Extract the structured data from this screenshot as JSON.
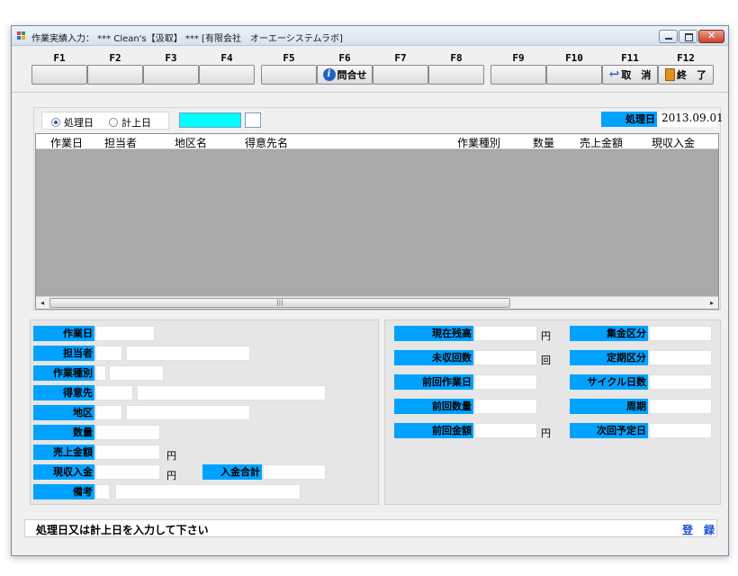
{
  "window": {
    "title": "作業実績入力： *** Clean's【汲取】 *** [有限会社　オーエーシステムラボ]"
  },
  "fkeys": [
    {
      "key": "F1",
      "label": ""
    },
    {
      "key": "F2",
      "label": ""
    },
    {
      "key": "F3",
      "label": ""
    },
    {
      "key": "F4",
      "label": ""
    },
    {
      "key": "F5",
      "label": ""
    },
    {
      "key": "F6",
      "label": "問合せ",
      "icon": "info-icon"
    },
    {
      "key": "F7",
      "label": ""
    },
    {
      "key": "F8",
      "label": ""
    },
    {
      "key": "F9",
      "label": ""
    },
    {
      "key": "F10",
      "label": ""
    },
    {
      "key": "F11",
      "label": "取　消",
      "icon": "undo-arrow-icon"
    },
    {
      "key": "F12",
      "label": "終　了",
      "icon": "exit-door-icon"
    }
  ],
  "search": {
    "radio_process_date": "処理日",
    "radio_posting_date": "計上日",
    "selected_radio": "処理日",
    "date_input_value": "",
    "small_input_value": "",
    "process_date_label": "処理日",
    "process_date_value": "2013.09.01"
  },
  "grid": {
    "columns": [
      "作業日",
      "担当者",
      "地区名",
      "得意先名",
      "作業種別",
      "数量",
      "売上金額",
      "現収入金"
    ],
    "rows": []
  },
  "left_form": {
    "work_date": {
      "label": "作業日",
      "value": ""
    },
    "staff": {
      "label": "担当者",
      "code": "",
      "name": ""
    },
    "work_type": {
      "label": "作業種別",
      "code": "",
      "name": ""
    },
    "customer": {
      "label": "得意先",
      "code": "",
      "name": ""
    },
    "district": {
      "label": "地区",
      "code": "",
      "name": ""
    },
    "quantity": {
      "label": "数量",
      "value": ""
    },
    "sales_amount": {
      "label": "売上金額",
      "value": "",
      "unit": "円"
    },
    "cash_received": {
      "label": "現収入金",
      "value": "",
      "unit": "円"
    },
    "payment_total": {
      "label": "入金合計",
      "value": ""
    },
    "remarks": {
      "label": "備考",
      "code": "",
      "text": ""
    }
  },
  "right_form": {
    "current_balance": {
      "label": "現在残高",
      "value": "",
      "unit": "円"
    },
    "unpaid_count": {
      "label": "未収回数",
      "value": "",
      "unit": "回"
    },
    "prev_work_date": {
      "label": "前回作業日",
      "value": ""
    },
    "prev_quantity": {
      "label": "前回数量",
      "value": ""
    },
    "prev_amount": {
      "label": "前回金額",
      "value": "",
      "unit": "円"
    },
    "collection_type": {
      "label": "集金区分",
      "value": ""
    },
    "regular_type": {
      "label": "定期区分",
      "value": ""
    },
    "cycle_days": {
      "label": "サイクル日数",
      "value": ""
    },
    "period": {
      "label": "周期",
      "value": ""
    },
    "next_scheduled_date": {
      "label": "次回予定日",
      "value": ""
    }
  },
  "status": {
    "message": "処理日又は計上日を入力して下さい",
    "register_label": "登　録"
  },
  "colors": {
    "label_bg": "#00a2ff",
    "date_input_bg": "#00ffff",
    "grid_bg": "#a9a9a9",
    "register_text": "#1f4fd6"
  }
}
